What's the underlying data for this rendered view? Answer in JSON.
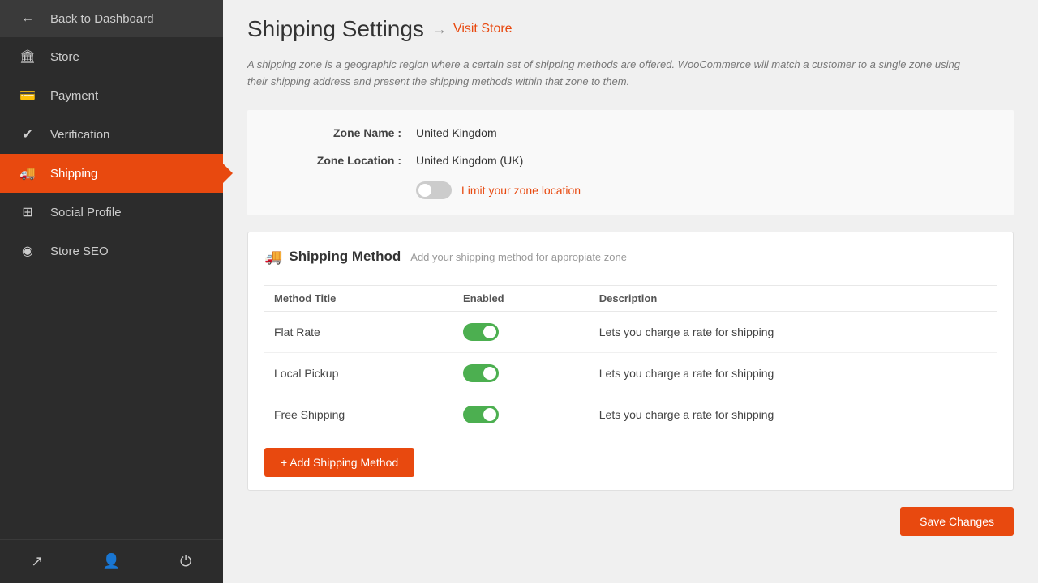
{
  "sidebar": {
    "items": [
      {
        "id": "back-dashboard",
        "label": "Back to Dashboard",
        "icon": "←",
        "active": false
      },
      {
        "id": "store",
        "label": "Store",
        "icon": "🏛",
        "active": false
      },
      {
        "id": "payment",
        "label": "Payment",
        "icon": "💳",
        "active": false
      },
      {
        "id": "verification",
        "label": "Verification",
        "icon": "✔",
        "active": false
      },
      {
        "id": "shipping",
        "label": "Shipping",
        "icon": "🚚",
        "active": true
      },
      {
        "id": "social-profile",
        "label": "Social Profile",
        "icon": "⊞",
        "active": false
      },
      {
        "id": "store-seo",
        "label": "Store SEO",
        "icon": "◉",
        "active": false
      }
    ],
    "bottom_items": [
      {
        "id": "external",
        "icon": "↗"
      },
      {
        "id": "user",
        "icon": "👤"
      },
      {
        "id": "power",
        "icon": "⏻"
      }
    ]
  },
  "page": {
    "title": "Shipping Settings",
    "arrow": "→",
    "visit_store_label": "Visit Store",
    "description": "A shipping zone is a geographic region where a certain set of shipping methods are offered. WooCommerce will match a customer to a single zone using their shipping address and present the shipping methods within that zone to them."
  },
  "form": {
    "zone_name_label": "Zone Name :",
    "zone_name_value": "United Kingdom",
    "zone_location_label": "Zone Location :",
    "zone_location_value": "United Kingdom (UK)",
    "limit_zone_label": "Limit your zone location"
  },
  "shipping_method": {
    "section_title": "Shipping Method",
    "section_subtitle": "Add your shipping method for appropiate zone",
    "columns": [
      "Method Title",
      "Enabled",
      "Description"
    ],
    "rows": [
      {
        "title": "Flat Rate",
        "enabled": true,
        "description": "Lets you charge a rate for shipping"
      },
      {
        "title": "Local Pickup",
        "enabled": true,
        "description": "Lets you charge a rate for shipping"
      },
      {
        "title": "Free Shipping",
        "enabled": true,
        "description": "Lets you charge a rate for shipping"
      }
    ],
    "add_button_label": "+ Add Shipping Method",
    "save_button_label": "Save Changes"
  }
}
